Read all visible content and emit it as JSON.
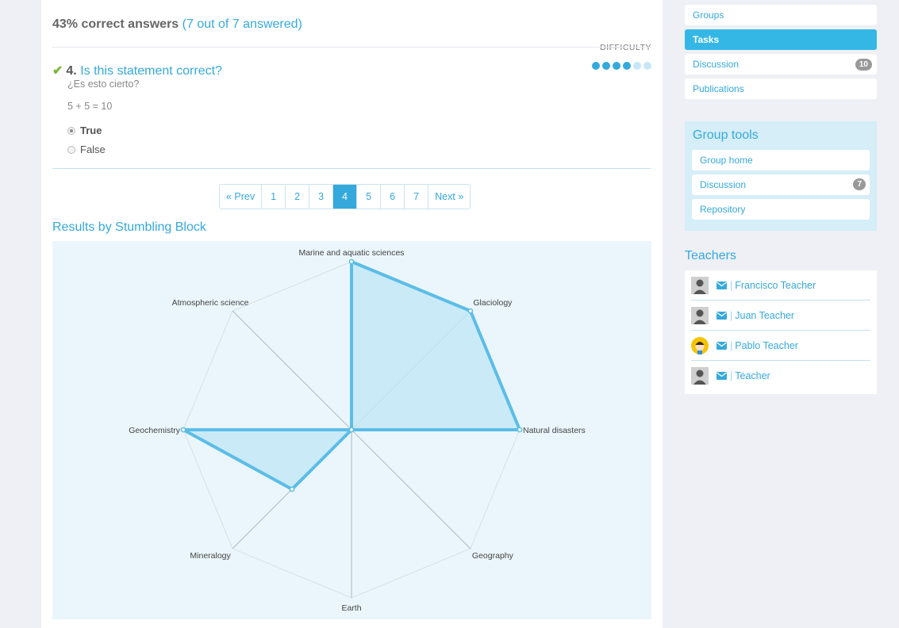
{
  "quiz": {
    "score_text": "43% correct answers",
    "answered_text": "(7 out of 7 answered)",
    "difficulty_label": "DIFFICULTY",
    "difficulty": {
      "level": 4,
      "max": 6
    },
    "question": {
      "number": "4.",
      "title": "Is this statement correct?",
      "subtitle": "¿Es esto cierto?",
      "statement": "5 + 5 = 10",
      "options": [
        {
          "label": "True",
          "selected": true
        },
        {
          "label": "False",
          "selected": false
        }
      ]
    }
  },
  "pagination": {
    "prev": "« Prev",
    "next": "Next »",
    "pages": [
      "1",
      "2",
      "3",
      "4",
      "5",
      "6",
      "7"
    ],
    "current": "4"
  },
  "results_title": "Results by Stumbling Block",
  "chart_data": {
    "type": "radar",
    "categories": [
      "Marine and aquatic sciences",
      "Glaciology",
      "Natural disasters",
      "Geography",
      "Earth",
      "Mineralogy",
      "Geochemistry",
      "Atmospheric science"
    ],
    "values": [
      1.0,
      1.0,
      1.0,
      0,
      0,
      0.5,
      1.0,
      0
    ],
    "range": [
      0,
      1
    ],
    "colors": {
      "line": "#5cbde6",
      "fill": "#c4e7f7",
      "grid": "#cfd8de",
      "spoke": "#b5c2ca"
    }
  },
  "sidebar": {
    "nav": [
      {
        "label": "Groups",
        "active": false,
        "badge": ""
      },
      {
        "label": "Tasks",
        "active": true,
        "badge": ""
      },
      {
        "label": "Discussion",
        "active": false,
        "badge": "10"
      },
      {
        "label": "Publications",
        "active": false,
        "badge": ""
      }
    ],
    "tools_title": "Group tools",
    "tools": [
      {
        "label": "Group home",
        "badge": ""
      },
      {
        "label": "Discussion",
        "badge": "7"
      },
      {
        "label": "Repository",
        "badge": ""
      }
    ],
    "teachers_title": "Teachers",
    "teachers": [
      {
        "name": "Francisco Teacher",
        "avatar": "default-avatar-icon"
      },
      {
        "name": "Juan Teacher",
        "avatar": "default-avatar-icon"
      },
      {
        "name": "Pablo Teacher",
        "avatar": "cartoon-avatar-icon"
      },
      {
        "name": "Teacher",
        "avatar": "default-avatar-icon"
      }
    ]
  },
  "colors": {
    "accent": "#35a9dc",
    "check": "#7cb83a"
  }
}
